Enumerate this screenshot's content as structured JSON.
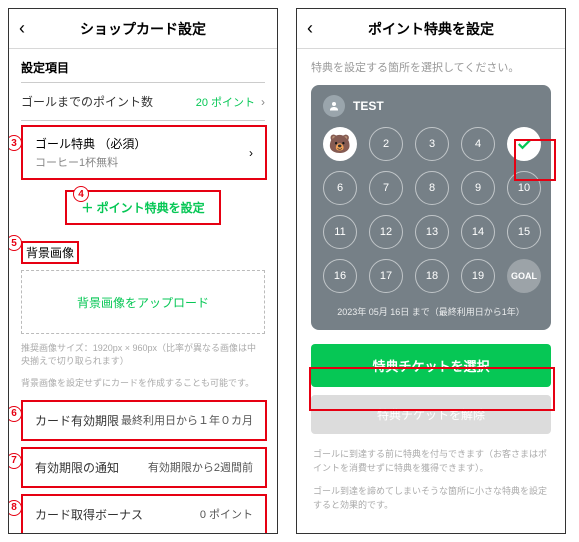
{
  "left": {
    "title": "ショップカード設定",
    "section": "設定項目",
    "points_row": {
      "label": "ゴールまでのポイント数",
      "value": "20 ポイント"
    },
    "goal": {
      "label": "ゴール特典 （必須）",
      "sub": "コーヒー1杯無料"
    },
    "add_bonus": "＋ ポイント特典を設定",
    "bg_label": "背景画像",
    "bg_upload": "背景画像をアップロード",
    "hint1": "推奨画像サイズ：1920px × 960px（比率が異なる画像は中央揃えで切り取られます）",
    "hint2": "背景画像を設定せずにカードを作成することも可能です。",
    "rows": {
      "expiry": {
        "label": "カード有効期限",
        "value": "最終利用日から１年０カ月"
      },
      "notify": {
        "label": "有効期限の通知",
        "value": "有効期限から2週間前"
      },
      "bonus": {
        "label": "カード取得ボーナス",
        "value": "0 ポイント"
      }
    },
    "badges": {
      "b3": "3",
      "b4": "4",
      "b5": "5",
      "b6": "6",
      "b7": "7",
      "b8": "8"
    }
  },
  "right": {
    "title": "ポイント特典を設定",
    "helper": "特典を設定する箇所を選択してください。",
    "card_name": "TEST",
    "stamps": [
      "bear",
      "2",
      "3",
      "4",
      "check",
      "6",
      "7",
      "8",
      "9",
      "10",
      "11",
      "12",
      "13",
      "14",
      "15",
      "16",
      "17",
      "18",
      "19",
      "GOAL"
    ],
    "footer": "2023年 05月 16日 まで（最終利用日から1年）",
    "primary": "特典チケットを選択",
    "disabled": "特典チケットを解除",
    "note1": "ゴールに到達する前に特典を付与できます（お客さまはポイントを消費せずに特典を獲得できます）。",
    "note2": "ゴール到達を諦めてしまいそうな箇所に小さな特典を設定すると効果的です。"
  }
}
